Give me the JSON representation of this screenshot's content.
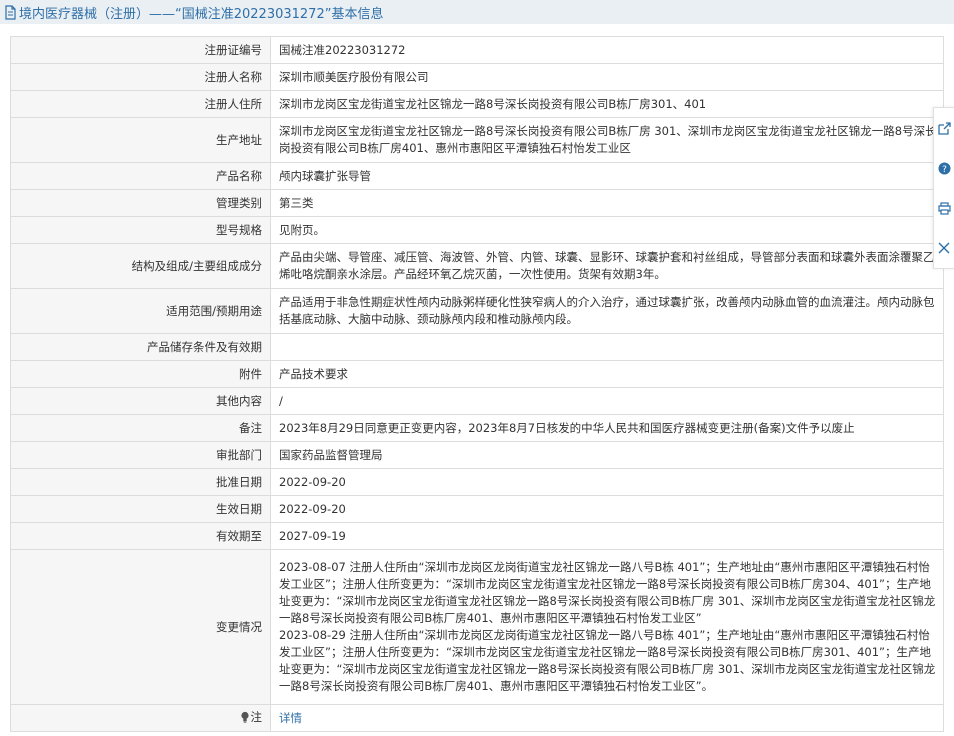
{
  "header": {
    "icon": "document-icon",
    "title": "境内医疗器械（注册）——“国械注准20223031272”基本信息"
  },
  "rows": [
    {
      "label": "注册证编号",
      "value": "国械注准20223031272"
    },
    {
      "label": "注册人名称",
      "value": "深圳市顺美医疗股份有限公司"
    },
    {
      "label": "注册人住所",
      "value": "深圳市龙岗区宝龙街道宝龙社区锦龙一路8号深长岗投资有限公司B栋厂房301、401"
    },
    {
      "label": "生产地址",
      "value": "深圳市龙岗区宝龙街道宝龙社区锦龙一路8号深长岗投资有限公司B栋厂房 301、深圳市龙岗区宝龙街道宝龙社区锦龙一路8号深长岗投资有限公司B栋厂房401、惠州市惠阳区平潭镇独石村怡发工业区"
    },
    {
      "label": "产品名称",
      "value": "颅内球囊扩张导管"
    },
    {
      "label": "管理类别",
      "value": "第三类"
    },
    {
      "label": "型号规格",
      "value": "见附页。"
    },
    {
      "label": "结构及组成/主要组成成分",
      "value": "产品由尖端、导管座、减压管、海波管、外管、内管、球囊、显影环、球囊护套和衬丝组成，导管部分表面和球囊外表面涂覆聚乙烯吡咯烷酮亲水涂层。产品经环氧乙烷灭菌，一次性使用。货架有效期3年。"
    },
    {
      "label": "适用范围/预期用途",
      "value": "产品适用于非急性期症状性颅内动脉粥样硬化性狭窄病人的介入治疗，通过球囊扩张，改善颅内动脉血管的血流灌注。颅内动脉包括基底动脉、大脑中动脉、颈动脉颅内段和椎动脉颅内段。"
    },
    {
      "label": "产品储存条件及有效期",
      "value": ""
    },
    {
      "label": "附件",
      "value": "产品技术要求"
    },
    {
      "label": "其他内容",
      "value": "/"
    },
    {
      "label": "备注",
      "value": "2023年8月29日同意更正变更内容，2023年8月7日核发的中华人民共和国医疗器械变更注册(备案)文件予以废止"
    },
    {
      "label": "审批部门",
      "value": "国家药品监督管理局"
    },
    {
      "label": "批准日期",
      "value": "2022-09-20"
    },
    {
      "label": "生效日期",
      "value": "2022-09-20"
    },
    {
      "label": "有效期至",
      "value": "2027-09-19"
    }
  ],
  "changes": {
    "label": "变更情况",
    "entries": [
      "2023-08-07 注册人住所由“深圳市龙岗区龙岗街道宝龙社区锦龙一路八号B栋 401”；生产地址由“惠州市惠阳区平潭镇独石村怡发工业区”；注册人住所变更为：“深圳市龙岗区宝龙街道宝龙社区锦龙一路8号深长岗投资有限公司B栋厂房304、401”；生产地址变更为：“深圳市龙岗区宝龙街道宝龙社区锦龙一路8号深长岗投资有限公司B栋厂房 301、深圳市龙岗区宝龙街道宝龙社区锦龙一路8号深长岗投资有限公司B栋厂房401、惠州市惠阳区平潭镇独石村怡发工业区”",
      "2023-08-29 注册人住所由“深圳市龙岗区龙岗街道宝龙社区锦龙一路八号B栋 401”；生产地址由“惠州市惠阳区平潭镇独石村怡发工业区”；注册人住所变更为：“深圳市龙岗区宝龙街道宝龙社区锦龙一路8号深长岗投资有限公司B栋厂房301、401”；生产地址变更为：“深圳市龙岗区宝龙街道宝龙社区锦龙一路8号深长岗投资有限公司B栋厂房 301、深圳市龙岗区宝龙街道宝龙社区锦龙一路8号深长岗投资有限公司B栋厂房401、惠州市惠阳区平潭镇独石村怡发工业区”。"
    ]
  },
  "note": {
    "icon": "lightbulb-icon",
    "label": "注",
    "link": "详情"
  },
  "side_toolbar": {
    "icons": [
      "share-icon",
      "help-icon",
      "print-icon",
      "close-icon"
    ]
  }
}
